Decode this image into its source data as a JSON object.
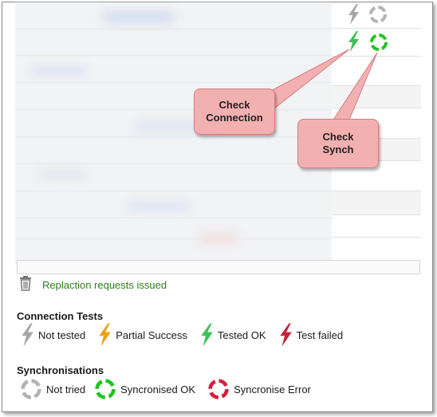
{
  "callouts": {
    "check_connection": "Check\nConnection",
    "check_synch": "Check\nSynch"
  },
  "status": {
    "message": "Replaction requests issued"
  },
  "legend": {
    "connection_title": "Connection Tests",
    "connection_items": [
      {
        "label": "Not tested",
        "icon": "bolt-gray-icon",
        "color": "#a6a6a6"
      },
      {
        "label": "Partial Success",
        "icon": "bolt-orange-icon",
        "color": "#e8a317"
      },
      {
        "label": "Tested OK",
        "icon": "bolt-green-icon",
        "color": "#3fc055"
      },
      {
        "label": "Test failed",
        "icon": "bolt-red-icon",
        "color": "#c4283b"
      }
    ],
    "sync_title": "Synchronisations",
    "sync_items": [
      {
        "label": "Not tried",
        "icon": "sync-gray-icon",
        "color": "#b3b3b3"
      },
      {
        "label": "Syncronised OK",
        "icon": "sync-green-icon",
        "color": "#1ec51e"
      },
      {
        "label": "Syncronise Error",
        "icon": "sync-red-icon",
        "color": "#d21f3c"
      }
    ]
  }
}
